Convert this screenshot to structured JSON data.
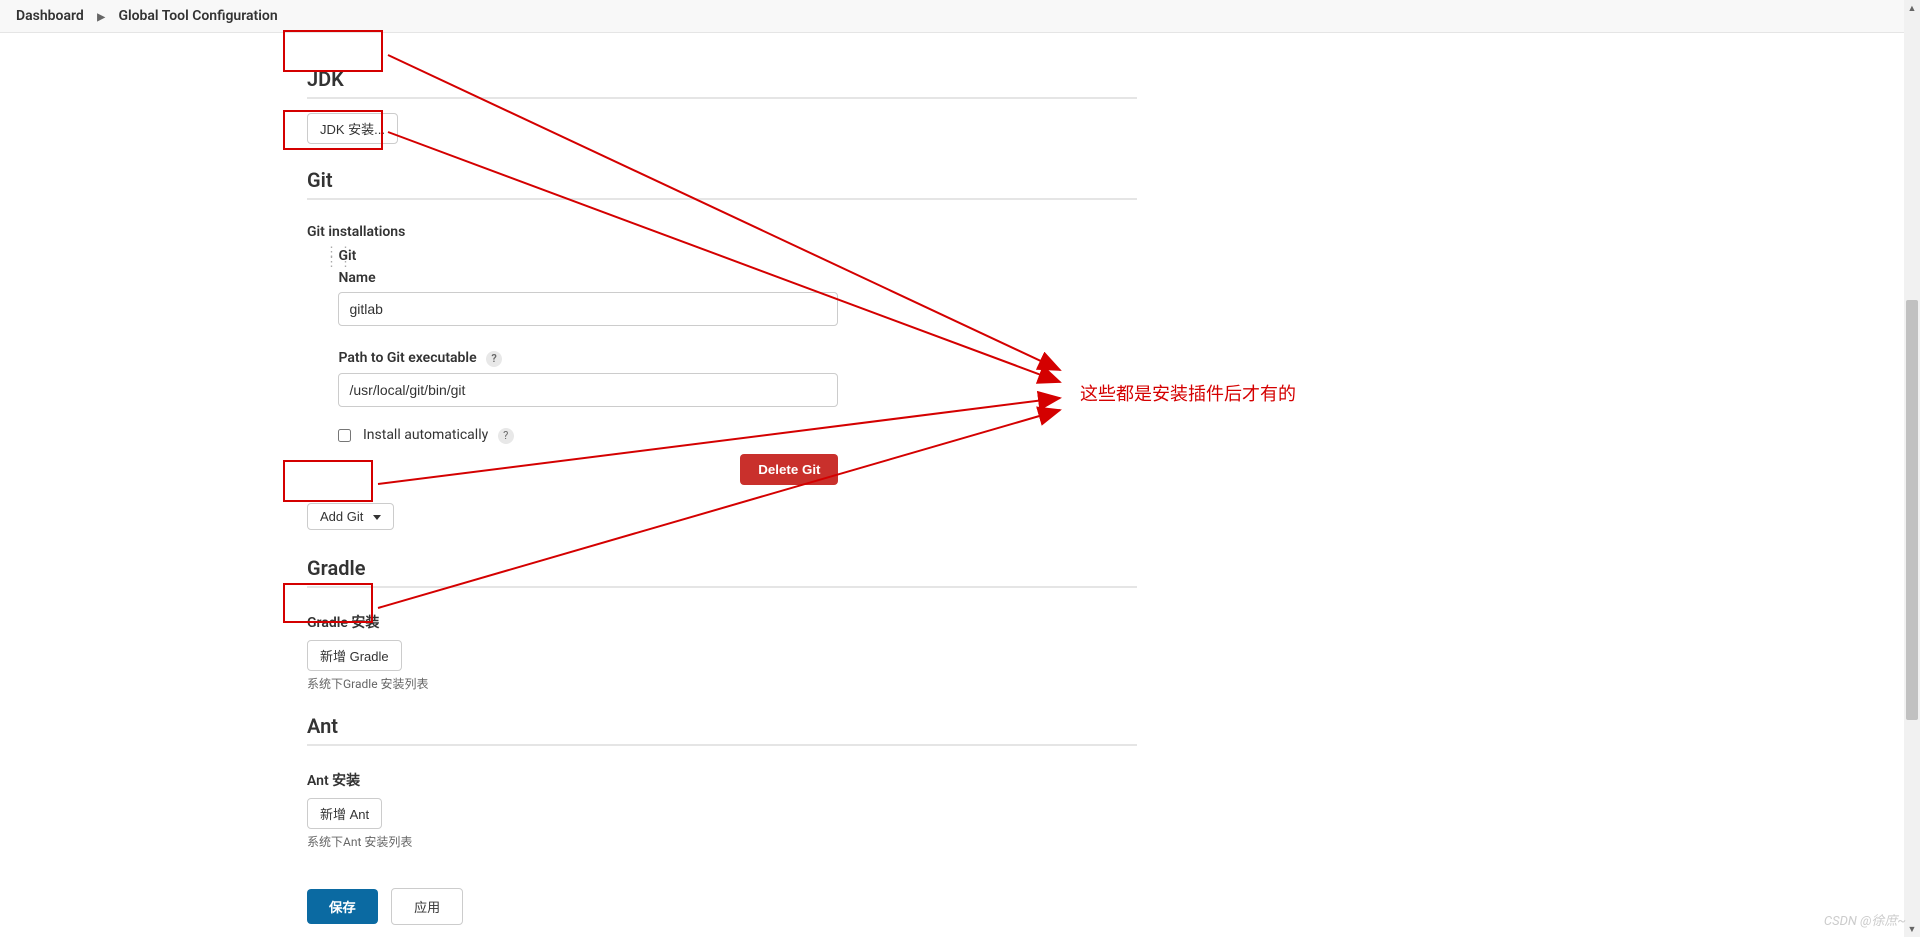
{
  "breadcrumb": {
    "dashboard": "Dashboard",
    "page": "Global Tool Configuration"
  },
  "jdk": {
    "title": "JDK",
    "install_btn": "JDK 安装..."
  },
  "git": {
    "title": "Git",
    "installations_label": "Git installations",
    "git_header": "Git",
    "name_label": "Name",
    "name_value": "gitlab",
    "path_label": "Path to Git executable",
    "path_value": "/usr/local/git/bin/git",
    "auto_install_label": "Install automatically",
    "delete_btn": "Delete Git",
    "add_btn": "Add Git"
  },
  "gradle": {
    "title": "Gradle",
    "install_label": "Gradle 安装",
    "add_btn": "新增 Gradle",
    "desc": "系统下Gradle 安装列表"
  },
  "ant": {
    "title": "Ant",
    "install_label": "Ant 安装",
    "add_btn": "新增 Ant",
    "desc": "系统下Ant 安装列表"
  },
  "buttons": {
    "save": "保存",
    "apply": "应用"
  },
  "annotation": "这些都是安装插件后才有的",
  "watermark": "CSDN @徐庶~"
}
